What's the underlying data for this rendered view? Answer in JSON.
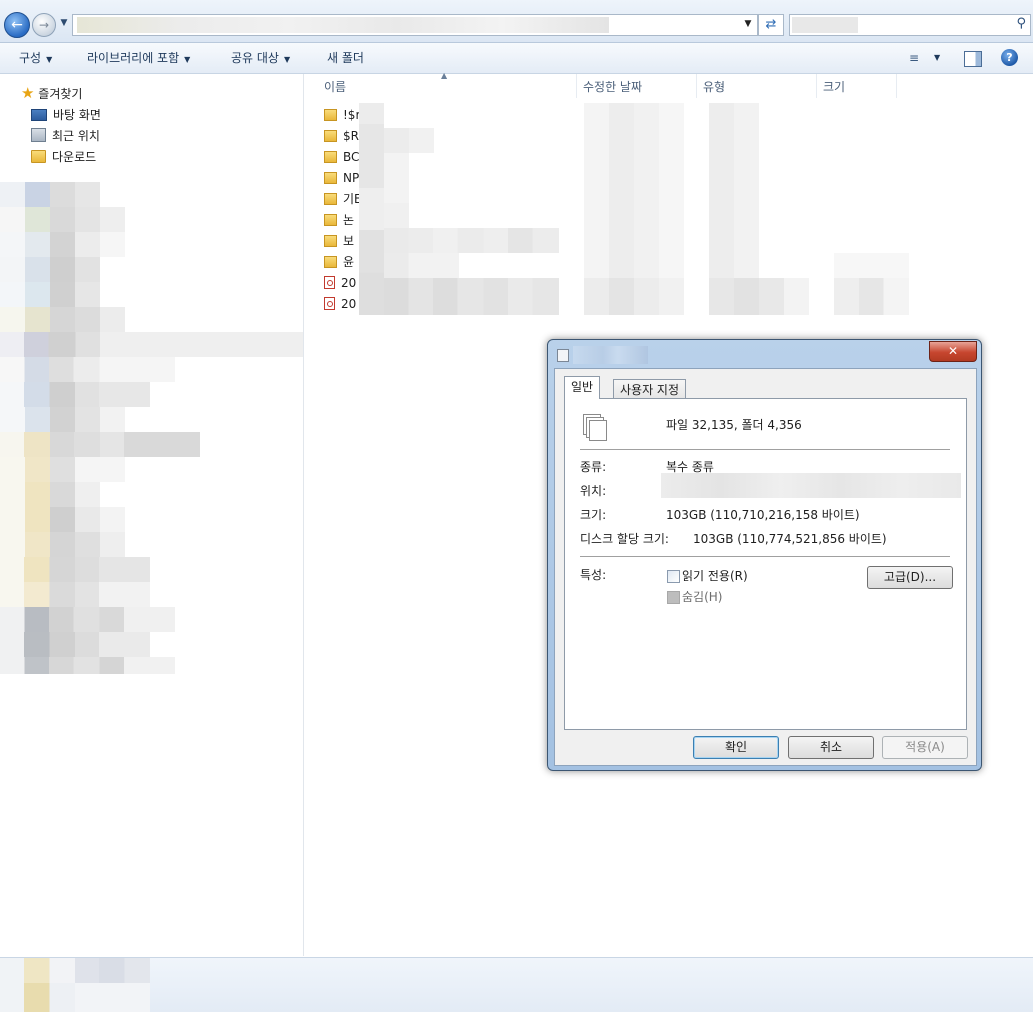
{
  "toolbar": {
    "organize": "구성",
    "include_in_library": "라이브러리에 포함",
    "share_with": "공유 대상",
    "new_folder": "새 폴더"
  },
  "nav": {
    "favorites": "즐겨찾기",
    "items": [
      {
        "label": "바탕 화면",
        "icon": "desktop-icon"
      },
      {
        "label": "최근 위치",
        "icon": "recent-places-icon"
      },
      {
        "label": "다운로드",
        "icon": "downloads-folder-icon"
      }
    ]
  },
  "columns": {
    "name": "이름",
    "date_modified": "수정한 날짜",
    "type": "유형",
    "size": "크기"
  },
  "files": [
    {
      "name": "!$r",
      "icon": "folder-icon"
    },
    {
      "name": "$R",
      "icon": "folder-icon"
    },
    {
      "name": "BC",
      "icon": "folder-icon"
    },
    {
      "name": "NP",
      "icon": "folder-icon"
    },
    {
      "name": "기E",
      "icon": "folder-icon"
    },
    {
      "name": "논",
      "icon": "folder-icon"
    },
    {
      "name": "보",
      "icon": "folder-icon"
    },
    {
      "name": "윤",
      "icon": "folder-icon"
    },
    {
      "name": "20",
      "icon": "pdf-icon"
    },
    {
      "name": "20",
      "icon": "pdf-icon"
    }
  ],
  "dialog": {
    "close": "✕",
    "tabs": {
      "general": "일반",
      "custom": "사용자 지정"
    },
    "summary": "파일 32,135, 폴더 4,356",
    "type_label": "종류:",
    "type_value": "복수 종류",
    "location_label": "위치:",
    "size_label": "크기:",
    "size_value": "103GB (110,710,216,158 바이트)",
    "disk_size_label": "디스크 할당 크기:",
    "disk_size_value": "103GB (110,774,521,856 바이트)",
    "attributes_label": "특성:",
    "readonly_label": "읽기 전용(R)",
    "hidden_label": "숨김(H)",
    "advanced_button": "고급(D)...",
    "ok_button": "확인",
    "cancel_button": "취소",
    "apply_button": "적용(A)"
  }
}
